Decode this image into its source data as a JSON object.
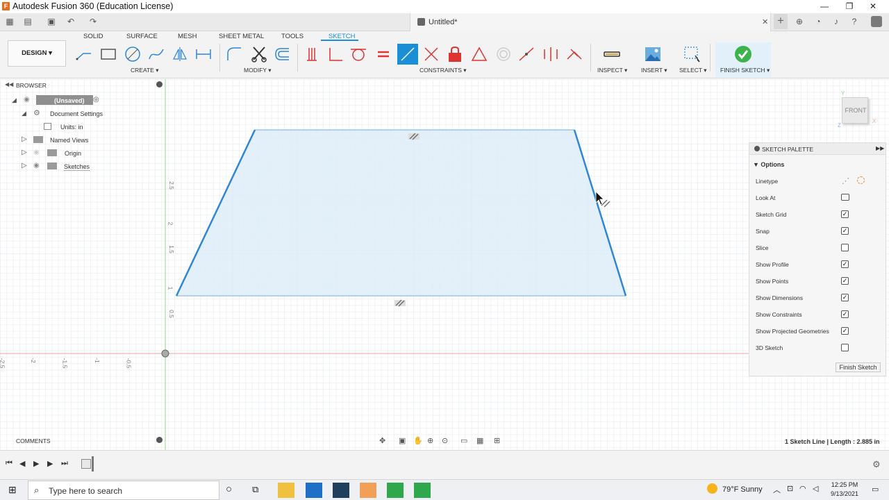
{
  "window": {
    "title": "Autodesk Fusion 360 (Education License)",
    "min": "—",
    "max": "❐",
    "close": "✕"
  },
  "tabbar": {
    "doc_title": "Untitled*",
    "close_x": "✕",
    "plus": "+"
  },
  "workspace_tabs": [
    "SOLID",
    "SURFACE",
    "MESH",
    "SHEET METAL",
    "TOOLS",
    "SKETCH"
  ],
  "design_button": "DESIGN ▾",
  "groups": {
    "create": "CREATE ▾",
    "modify": "MODIFY ▾",
    "constraints": "CONSTRAINTS ▾",
    "inspect": "INSPECT ▾",
    "insert": "INSERT ▾",
    "select": "SELECT ▾",
    "finish_sketch": "FINISH SKETCH ▾"
  },
  "browser": {
    "header": "BROWSER",
    "items": [
      {
        "label": "(Unsaved)"
      },
      {
        "label": "Document Settings"
      },
      {
        "label": "Units: in"
      },
      {
        "label": "Named Views"
      },
      {
        "label": "Origin"
      },
      {
        "label": "Sketches"
      }
    ]
  },
  "viewcube": {
    "label": "FRONT"
  },
  "axis_labels": {
    "vertical": [
      "2.5",
      "2",
      "1.5",
      "1",
      "0.5"
    ],
    "horizontal": [
      "-2.5",
      "-2",
      "-1.5",
      "-1",
      "-0.5"
    ]
  },
  "sketch_palette": {
    "header": "SKETCH PALETTE",
    "section": "Options",
    "rows": [
      {
        "label": "Linetype",
        "kind": "icons"
      },
      {
        "label": "Look At",
        "kind": "icon"
      },
      {
        "label": "Sketch Grid",
        "checked": true
      },
      {
        "label": "Snap",
        "checked": true
      },
      {
        "label": "Slice",
        "checked": false
      },
      {
        "label": "Show Profile",
        "checked": true
      },
      {
        "label": "Show Points",
        "checked": true
      },
      {
        "label": "Show Dimensions",
        "checked": true
      },
      {
        "label": "Show Constraints",
        "checked": true
      },
      {
        "label": "Show Projected Geometries",
        "checked": true
      },
      {
        "label": "3D Sketch",
        "checked": false
      }
    ],
    "finish_button": "Finish Sketch"
  },
  "comments": {
    "header": "COMMENTS"
  },
  "status": {
    "text": "1 Sketch Line | Length : 2.885 in"
  },
  "taskbar": {
    "search_placeholder": "Type here to search",
    "weather": "79°F  Sunny",
    "time": "12:25 PM",
    "date": "9/13/2021"
  },
  "colors": {
    "accent": "#1a8fd6",
    "sketch_line": "#2f86d6",
    "profile_fill": "#dcecf8",
    "finish_green": "#3cb44b"
  }
}
